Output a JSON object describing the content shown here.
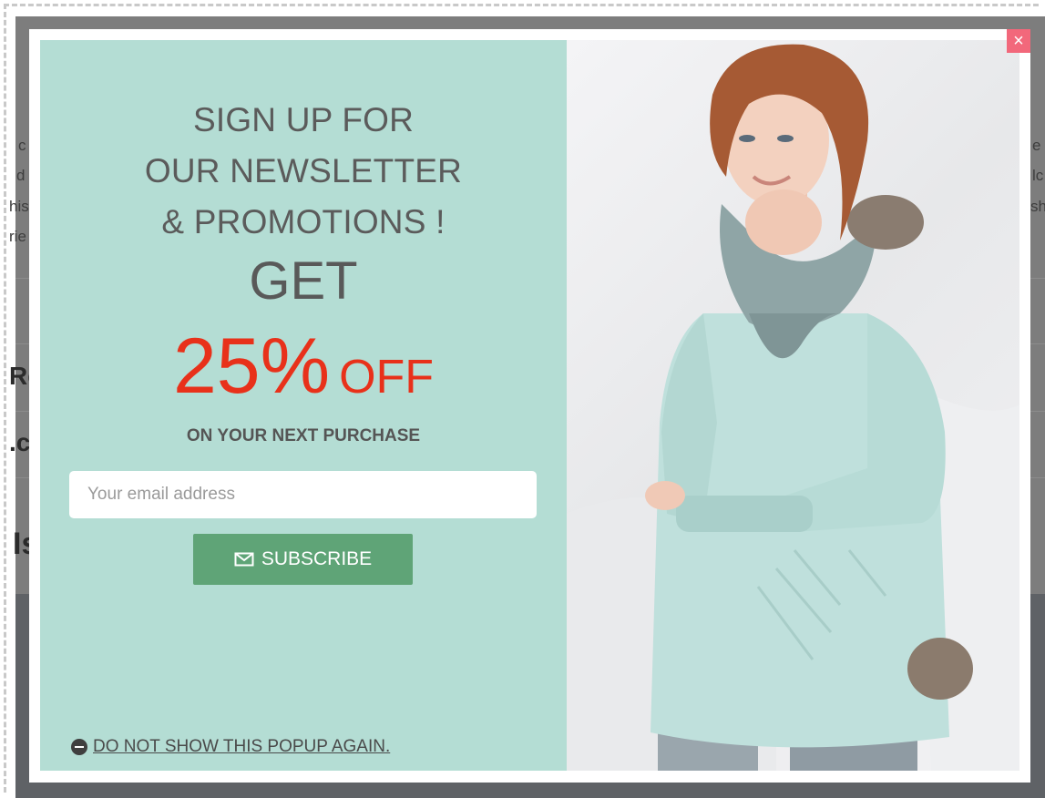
{
  "background_page": {
    "fragments": [
      "c",
      "d",
      "his",
      "rie",
      "Re",
      ".c",
      "Is",
      "e",
      "lc",
      "sh"
    ]
  },
  "popup": {
    "close_label": "×",
    "headline_lines": [
      "SIGN UP FOR",
      "OUR NEWSLETTER",
      "& PROMOTIONS !"
    ],
    "get_label": "GET",
    "discount_value": "25%",
    "discount_suffix": "OFF",
    "subline": "ON YOUR NEXT PURCHASE",
    "email_placeholder": "Your email address",
    "email_value": "",
    "subscribe_label": "SUBSCRIBE",
    "subscribe_icon": "envelope-icon",
    "dismiss_icon": "minus-circle-icon",
    "dismiss_label": "DO NOT SHOW THIS POPUP AGAIN.",
    "image_subject": "woman in mint sweater",
    "colors": {
      "panel_bg": "#b4ddd4",
      "accent_red": "#e8311a",
      "button_green": "#5fa477",
      "close_pink": "#f2687b"
    }
  }
}
